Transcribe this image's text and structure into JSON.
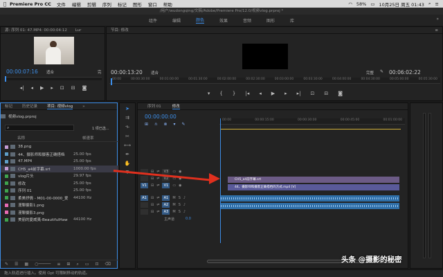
{
  "menubar": {
    "app": "Premiere Pro CC",
    "items": [
      "文件",
      "编辑",
      "剪辑",
      "序列",
      "标记",
      "图形",
      "窗口",
      "帮助"
    ],
    "battery": "58%",
    "datetime": "10月25日 周五 01:43"
  },
  "titlebar": {
    "path": "/用户/wudongqing/文稿/Adobe/Premiere Pro/12.0/视频vlog.prproj *"
  },
  "workspaces": {
    "items": [
      "组件",
      "编辑",
      "颜色",
      "效果",
      "音频",
      "图形",
      "库"
    ],
    "active_index": 2
  },
  "source_monitor": {
    "tab": "源: 序列 01: 47.MP4: 00:00:04:12",
    "tab2": "Lur",
    "timecode": "00:00:07:16",
    "fit": "适合",
    "fit_tail": "完"
  },
  "program_monitor": {
    "tab": "节目: 修改",
    "timecode": "00:00:13:20",
    "fit": "适合",
    "quality": "完整",
    "duration": "00:06:02:22",
    "ruler": [
      "00:00",
      "00:00:30:00",
      "00:01:00:00",
      "00:01:30:00",
      "00:02:00:00",
      "00:02:30:00",
      "00:03:00:00",
      "00:03:30:00",
      "00:04:00:00",
      "00:04:30:00",
      "00:05:00:00",
      "00:05:30:00"
    ]
  },
  "project_panel": {
    "tabs": [
      "标记",
      "历史记录",
      "项目: 视频vlog"
    ],
    "active_tab": 2,
    "project_file": "视频vlog.prproj",
    "selection_info": "1 项已选...",
    "columns": {
      "name": "名称",
      "rate": "帧速率"
    },
    "items": [
      {
        "name": "38.png",
        "rate": "",
        "color": "#c39bd3"
      },
      {
        "name": "44、摄影师和摄客正确搭档",
        "rate": "25.00 fps",
        "color": "#5f9ec7"
      },
      {
        "name": "47.MP4",
        "rate": "25.00 fps",
        "color": "#5f9ec7"
      },
      {
        "name": "CH5_a4前字幕.srt",
        "rate": "1000.00 fps",
        "color": "#c39bd3",
        "selected": true
      },
      {
        "name": "vlog片头",
        "rate": "29.97 fps",
        "color": "#3fa34d"
      },
      {
        "name": "修改",
        "rate": "25.00 fps",
        "color": "#3fa34d"
      },
      {
        "name": "序列 01",
        "rate": "25.00 fps",
        "color": "#3fa34d"
      },
      {
        "name": "柔美抒情 - M01-00-0000_爱",
        "rate": "44100 Hz",
        "color": "#3fa34d"
      },
      {
        "name": "漫聊摄影1.png",
        "rate": "",
        "color": "#e86bb3"
      },
      {
        "name": "漫聊摄影3.png",
        "rate": "",
        "color": "#e86bb3"
      },
      {
        "name": "美丽的夏威夷-BeautifulHaw",
        "rate": "44100 Hz",
        "color": "#3fa34d"
      }
    ]
  },
  "timeline": {
    "tabs": [
      "序列 01",
      "修改"
    ],
    "active_tab": 1,
    "timecode": "00:00:00:00",
    "ruler": [
      "00:00",
      "00:00:15:00",
      "00:00:30:00",
      "00:00:45:00",
      "00:01:00:00"
    ],
    "video_tracks": [
      {
        "label": "V3",
        "src": ""
      },
      {
        "label": "V2",
        "src": ""
      },
      {
        "label": "V1",
        "src": "V1"
      }
    ],
    "audio_tracks": [
      {
        "label": "A1",
        "src": "A1",
        "m": "M",
        "s": "S"
      },
      {
        "label": "A2",
        "src": "A2",
        "m": "M",
        "s": "S"
      },
      {
        "label": "A3",
        "src": "A3",
        "m": "M",
        "s": "S"
      }
    ],
    "master": {
      "label": "主声道",
      "value": "0.0"
    },
    "clips": {
      "subtitle": "CH5_a4前字幕.srt",
      "video": "44、摄影师和摄客正确搭档的方式.mp4 [V]"
    }
  },
  "statusbar": {
    "text": "拖入轨道进行插入。使用 Opt 可限制移动的轨道。"
  },
  "watermark": {
    "text": "头条 @摄影的秘密"
  },
  "colors": {
    "accent": "#3d8ee8",
    "arrow": "#e0301e",
    "audio_clip": "#2f6fa8",
    "video_clip": "#5a5a9a",
    "subtitle_clip": "#6c5b86"
  }
}
